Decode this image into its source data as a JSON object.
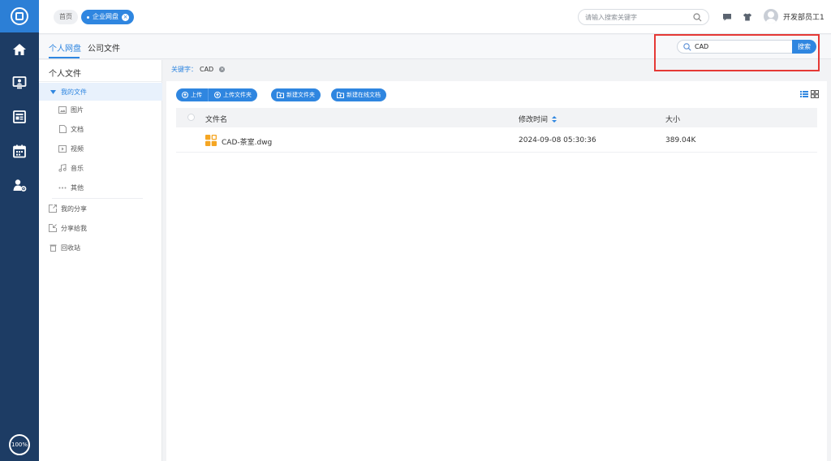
{
  "rail": {
    "zoom": "100%",
    "items": [
      "home-icon",
      "monitor-user-icon",
      "news-icon",
      "calendar-icon",
      "user-settings-icon"
    ]
  },
  "topbar": {
    "crumb_home": "首页",
    "crumb_active": "企业网盘",
    "search_placeholder": "请输入搜索关键字",
    "user_name": "开发部员工1"
  },
  "tabs": {
    "personal": "个人网盘",
    "company": "公司文件"
  },
  "keyword_search": {
    "value": "CAD",
    "button": "搜索"
  },
  "tree": {
    "title": "个人文件",
    "my_files": "我的文件",
    "children": [
      "图片",
      "文档",
      "视频",
      "音乐",
      "其他"
    ],
    "my_share": "我的分享",
    "shared_to_me": "分享给我",
    "recycle": "回收站"
  },
  "main": {
    "keyword_label": "关键字：",
    "keyword_value": "CAD",
    "buttons": {
      "upload": "上传",
      "upload_folder": "上传文件夹",
      "new_folder": "新建文件夹",
      "new_online_doc": "新建在线文档"
    },
    "columns": {
      "name": "文件名",
      "modified": "修改时间",
      "size": "大小"
    },
    "rows": [
      {
        "name": "CAD-茶室.dwg",
        "modified": "2024-09-08 05:30:36",
        "size": "389.04K"
      }
    ]
  },
  "colors": {
    "rail": "#1d3c64",
    "accent": "#2f86e0",
    "highlight": "#e53935",
    "file_icon": "#f5a623"
  }
}
